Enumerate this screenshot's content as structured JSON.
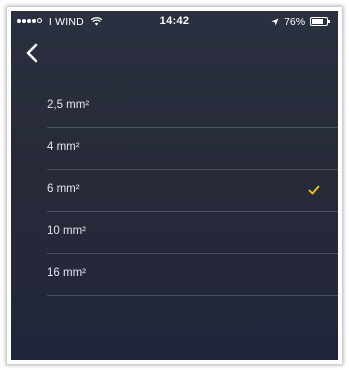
{
  "status_bar": {
    "carrier": "I WIND",
    "time": "14:42",
    "battery": "76%"
  },
  "nav": {
    "back_icon": "chevron-left-icon"
  },
  "options": [
    {
      "label": "2,5 mm²",
      "selected": false
    },
    {
      "label": "4 mm²",
      "selected": false
    },
    {
      "label": "6 mm²",
      "selected": true
    },
    {
      "label": "10 mm²",
      "selected": false
    },
    {
      "label": "16 mm²",
      "selected": false
    }
  ],
  "colors": {
    "background": "#262a39",
    "check": "#f5c518",
    "divider": "#4a4f60"
  }
}
